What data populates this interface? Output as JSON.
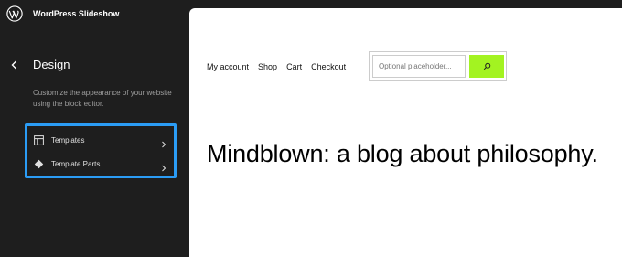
{
  "header": {
    "site_name": "WordPress Slideshow",
    "logo_icon": "wordpress-logo-icon"
  },
  "sidebar": {
    "back_icon": "chevron-left-icon",
    "title": "Design",
    "description": "Customize the appearance of your website using the block editor.",
    "highlight_color": "#2b9cf5",
    "items": [
      {
        "label": "Templates",
        "icon": "layout-icon",
        "chevron": "chevron-right-icon"
      },
      {
        "label": "Template Parts",
        "icon": "symbol-filled-icon",
        "chevron": "chevron-right-icon"
      }
    ]
  },
  "preview": {
    "nav": [
      "My account",
      "Shop",
      "Cart",
      "Checkout"
    ],
    "search": {
      "placeholder": "Optional placeholder...",
      "value": "",
      "button_icon": "search-icon",
      "button_color": "#a3f321"
    },
    "heading": "Mindblown: a blog about philosophy."
  }
}
